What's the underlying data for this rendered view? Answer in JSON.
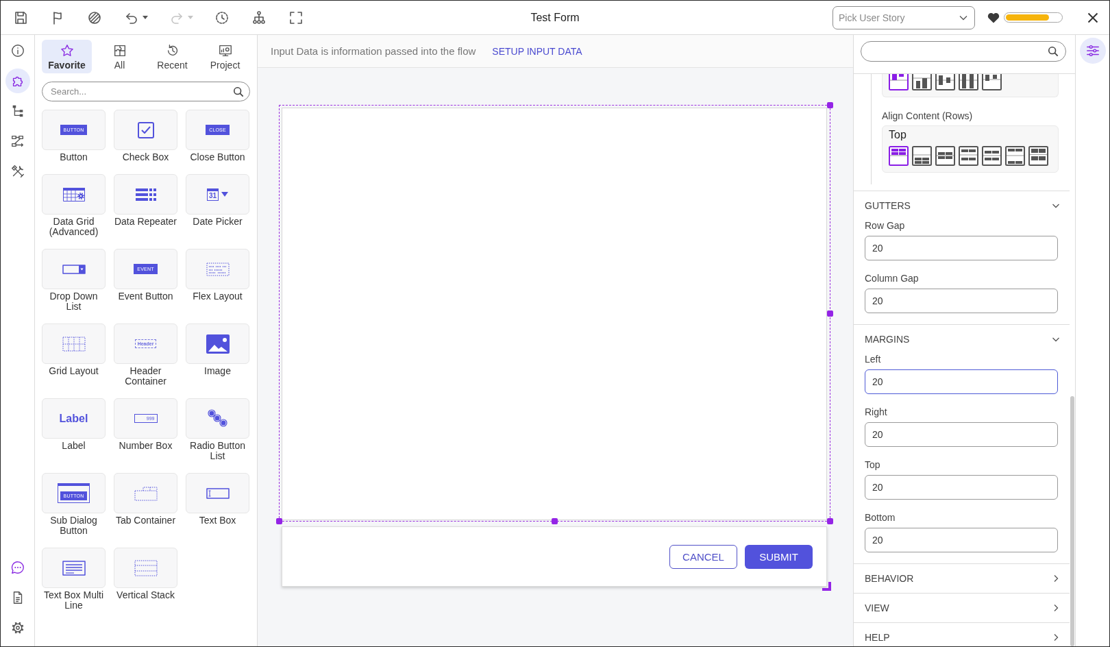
{
  "toolbar": {
    "buttons": [
      {
        "kind": "save",
        "disabled": false,
        "menu": false
      },
      {
        "kind": "flag",
        "disabled": false,
        "menu": false
      },
      {
        "kind": "palette",
        "disabled": false,
        "menu": false
      },
      {
        "kind": "undo",
        "disabled": false,
        "menu": true
      },
      {
        "kind": "redo",
        "disabled": true,
        "menu": true
      },
      {
        "kind": "history",
        "disabled": false,
        "menu": false
      },
      {
        "kind": "hierarchy",
        "disabled": false,
        "menu": false
      },
      {
        "kind": "fullscreen",
        "disabled": false,
        "menu": false
      }
    ],
    "title": "Test Form",
    "user_story": {
      "placeholder": "Pick User Story"
    },
    "health": {
      "level": 0.79
    }
  },
  "left_rail": {
    "top": [
      {
        "kind": "info",
        "selected": false
      },
      {
        "kind": "components",
        "selected": true
      },
      {
        "kind": "tree",
        "selected": false
      },
      {
        "kind": "flow",
        "selected": false
      },
      {
        "kind": "tools",
        "selected": false
      }
    ],
    "bottom": [
      {
        "kind": "chat",
        "selected": false
      },
      {
        "kind": "document",
        "selected": false
      },
      {
        "kind": "settings",
        "selected": false
      }
    ]
  },
  "palette": {
    "tabs": [
      {
        "label": "Favorite",
        "kind": "star",
        "selected": true
      },
      {
        "label": "All",
        "kind": "puzzle",
        "selected": false
      },
      {
        "label": "Recent",
        "kind": "history",
        "selected": false
      },
      {
        "label": "Project",
        "kind": "monitor",
        "selected": false
      }
    ],
    "search": {
      "placeholder": "Search..."
    },
    "items": [
      {
        "label": "Button",
        "kind": "button",
        "preview_text": "BUTTON"
      },
      {
        "label": "Check Box",
        "kind": "checkbox"
      },
      {
        "label": "Close Button",
        "kind": "close-button",
        "preview_text": "CLOSE"
      },
      {
        "label": "Data Grid (Advanced)",
        "kind": "data-grid"
      },
      {
        "label": "Data Repeater",
        "kind": "data-repeater"
      },
      {
        "label": "Date Picker",
        "kind": "date-picker",
        "preview_text": "31"
      },
      {
        "label": "Drop Down List",
        "kind": "dropdown"
      },
      {
        "label": "Event Button",
        "kind": "event-button",
        "preview_text": "EVENT"
      },
      {
        "label": "Flex Layout",
        "kind": "flex-layout"
      },
      {
        "label": "Grid Layout",
        "kind": "grid-layout"
      },
      {
        "label": "Header Container",
        "kind": "header-container",
        "preview_text": "Header"
      },
      {
        "label": "Image",
        "kind": "image"
      },
      {
        "label": "Label",
        "kind": "label",
        "preview_text": "Label"
      },
      {
        "label": "Number Box",
        "kind": "number-box",
        "preview_text": "999"
      },
      {
        "label": "Radio Button List",
        "kind": "radio-list"
      },
      {
        "label": "Sub Dialog Button",
        "kind": "sub-dialog",
        "preview_text": "BUTTON"
      },
      {
        "label": "Tab Container",
        "kind": "tab-container"
      },
      {
        "label": "Text Box",
        "kind": "text-box"
      },
      {
        "label": "Text Box Multi Line",
        "kind": "text-multiline"
      },
      {
        "label": "Vertical Stack",
        "kind": "vertical-stack"
      }
    ]
  },
  "canvas": {
    "info": {
      "text": "Input Data is information passed into the flow",
      "link": "SETUP INPUT DATA"
    },
    "form": {
      "selected": true,
      "buttons": [
        {
          "label": "CANCEL",
          "kind": "outline"
        },
        {
          "label": "SUBMIT",
          "kind": "primary"
        }
      ]
    }
  },
  "properties": {
    "clipped_group": {
      "options": [
        {
          "kind": "start",
          "selected": true
        },
        {
          "kind": "end",
          "selected": false
        },
        {
          "kind": "center",
          "selected": false
        },
        {
          "kind": "stretch",
          "selected": false
        },
        {
          "kind": "baseline",
          "selected": false
        }
      ]
    },
    "align_content": {
      "label": "Align Content (Rows)",
      "value": "Top",
      "options": [
        {
          "kind": "start",
          "selected": true
        },
        {
          "kind": "end",
          "selected": false
        },
        {
          "kind": "center",
          "selected": false
        },
        {
          "kind": "between",
          "selected": false
        },
        {
          "kind": "around",
          "selected": false
        },
        {
          "kind": "evenly",
          "selected": false
        },
        {
          "kind": "stretch",
          "selected": false
        }
      ]
    },
    "sections": [
      {
        "title": "GUTTERS",
        "expanded": true,
        "fields": [
          {
            "label": "Row Gap",
            "value": "20",
            "focused": false
          },
          {
            "label": "Column Gap",
            "value": "20",
            "focused": false
          }
        ]
      },
      {
        "title": "MARGINS",
        "expanded": true,
        "fields": [
          {
            "label": "Left",
            "value": "20",
            "focused": true
          },
          {
            "label": "Right",
            "value": "20",
            "focused": false
          },
          {
            "label": "Top",
            "value": "20",
            "focused": false
          },
          {
            "label": "Bottom",
            "value": "20",
            "focused": false
          }
        ]
      },
      {
        "title": "BEHAVIOR",
        "expanded": false
      },
      {
        "title": "VIEW",
        "expanded": false
      },
      {
        "title": "HELP",
        "expanded": false
      }
    ]
  },
  "right_rail": [
    {
      "kind": "properties",
      "selected": true
    }
  ]
}
